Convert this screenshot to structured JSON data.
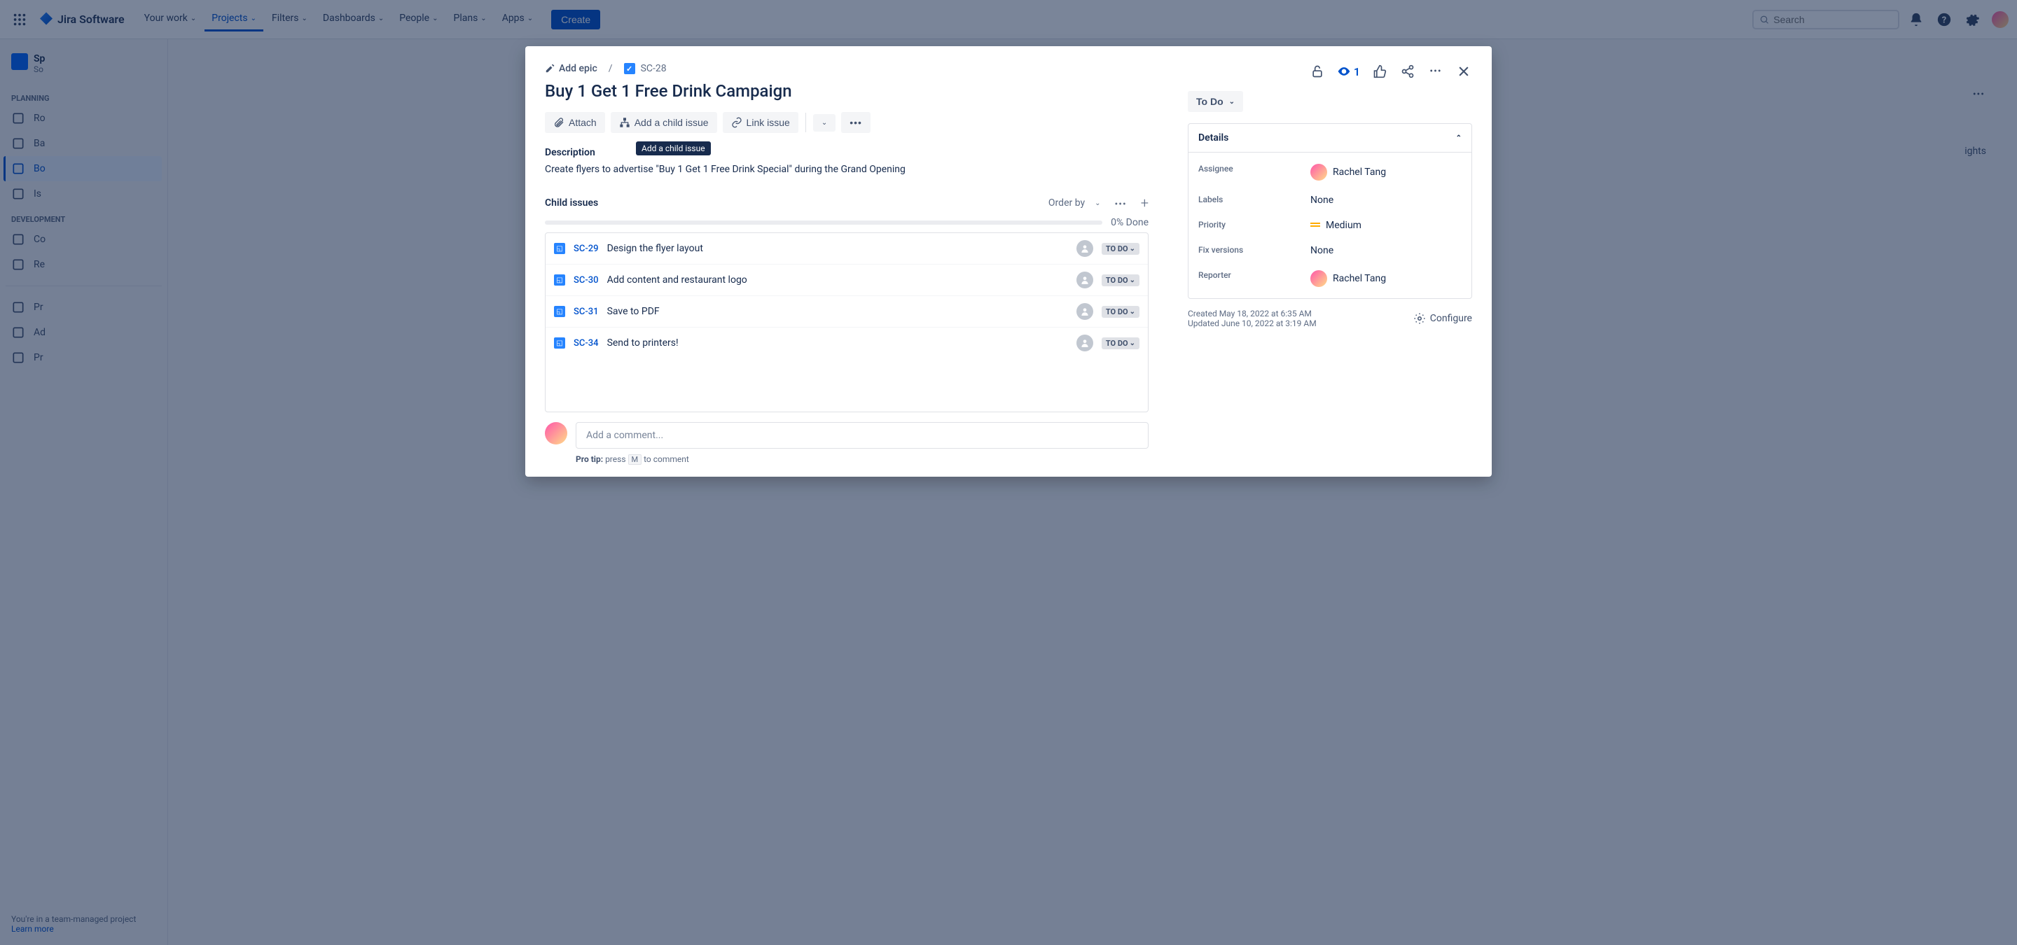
{
  "nav": {
    "product": "Jira Software",
    "links": [
      "Your work",
      "Projects",
      "Filters",
      "Dashboards",
      "People",
      "Plans",
      "Apps"
    ],
    "activeIndex": 1,
    "create": "Create",
    "searchPlaceholder": "Search"
  },
  "sidebar": {
    "projectName": "Sp",
    "projectType": "So",
    "planning": "PLANNING",
    "development": "DEVELOPMENT",
    "items_planning": [
      "Ro",
      "Ba",
      "Bo",
      "Is"
    ],
    "items_dev": [
      "Co",
      "Re"
    ],
    "items_bottom": [
      "Pr",
      "Ad",
      "Pr"
    ],
    "activePlanning": 2,
    "footer1": "You're in a team-managed project",
    "footer2": "Learn more"
  },
  "issue": {
    "addEpic": "Add epic",
    "key": "SC-28",
    "title": "Buy 1 Get 1 Free Drink Campaign",
    "actions": {
      "attach": "Attach",
      "addChild": "Add a child issue",
      "link": "Link issue"
    },
    "tooltip": "Add a child issue",
    "descLabel": "Description",
    "description": "Create flyers to advertise \"Buy 1 Get 1 Free Drink Special\" during the Grand Opening",
    "childLabel": "Child issues",
    "orderBy": "Order by",
    "progress": "0% Done",
    "children": [
      {
        "key": "SC-29",
        "summary": "Design the flyer layout",
        "status": "TO DO"
      },
      {
        "key": "SC-30",
        "summary": "Add content and restaurant logo",
        "status": "TO DO"
      },
      {
        "key": "SC-31",
        "summary": "Save to PDF",
        "status": "TO DO"
      },
      {
        "key": "SC-34",
        "summary": "Send to printers!",
        "status": "TO DO"
      }
    ],
    "commentPlaceholder": "Add a comment...",
    "proTip": {
      "label": "Pro tip:",
      "press": "press",
      "key": "M",
      "rest": "to comment"
    }
  },
  "right": {
    "watchCount": "1",
    "status": "To Do",
    "detailsLabel": "Details",
    "fields": {
      "assigneeLabel": "Assignee",
      "assignee": "Rachel Tang",
      "labelsLabel": "Labels",
      "labels": "None",
      "priorityLabel": "Priority",
      "priority": "Medium",
      "fixLabel": "Fix versions",
      "fix": "None",
      "reporterLabel": "Reporter",
      "reporter": "Rachel Tang"
    },
    "created": "Created May 18, 2022 at 6:35 AM",
    "updated": "Updated June 10, 2022 at 3:19 AM",
    "configure": "Configure"
  },
  "peek": {
    "insights": "ights"
  }
}
